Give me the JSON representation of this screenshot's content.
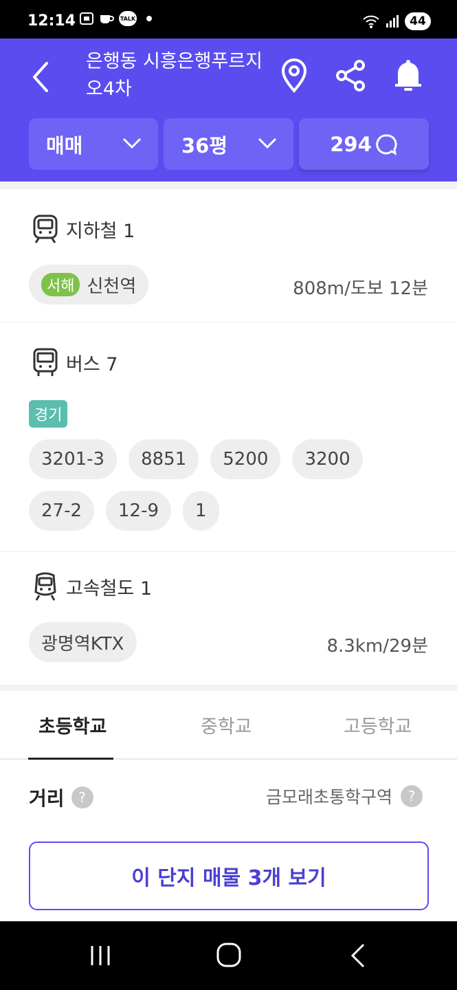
{
  "status_bar": {
    "time": "12:14",
    "battery": "44",
    "kakao_badge": "TALK"
  },
  "header": {
    "title": "은행동 시흥은행푸르지오4차",
    "filters": [
      {
        "label": "매매"
      },
      {
        "label": "36평"
      },
      {
        "label": "294"
      }
    ]
  },
  "transit": {
    "subway": {
      "title": "지하철 1",
      "line": "서해",
      "station": "신천역",
      "distance": "808m/도보 12분"
    },
    "bus": {
      "title": "버스 7",
      "region": "경기",
      "routes": [
        "3201-3",
        "8851",
        "5200",
        "3200",
        "27-2",
        "12-9",
        "1"
      ]
    },
    "express": {
      "title": "고속철도 1",
      "station": "광명역KTX",
      "distance": "8.3km/29분"
    }
  },
  "school": {
    "tabs": [
      "초등학교",
      "중학교",
      "고등학교"
    ],
    "distance_label": "거리",
    "district_label": "금모래초통학구역"
  },
  "cta": {
    "label": "이 단지 매물 3개 보기"
  }
}
